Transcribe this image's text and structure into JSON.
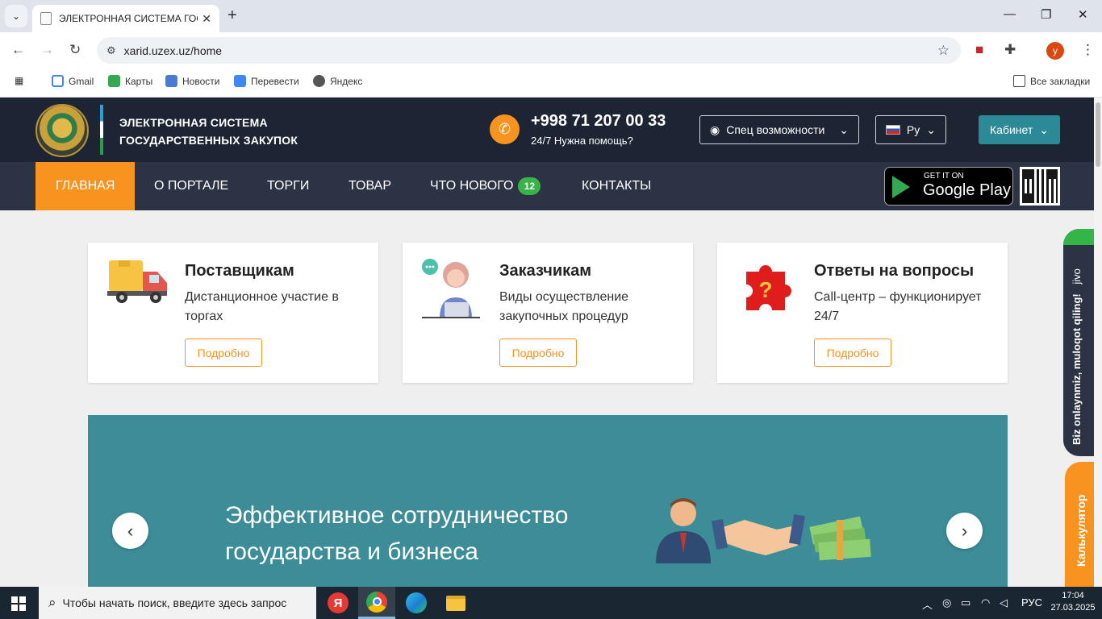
{
  "browser": {
    "tab_title": "ЭЛЕКТРОННАЯ СИСТЕМА ГОС",
    "url": "xarid.uzex.uz/home",
    "bookmarks": [
      "Gmail",
      "Карты",
      "Новости",
      "Перевести",
      "Яндекс"
    ],
    "all_bookmarks": "Все закладки",
    "profile_initial": "у"
  },
  "header": {
    "brand_line1": "ЭЛЕКТРОННАЯ СИСТЕМА",
    "brand_line2": "ГОСУДАРСТВЕННЫХ ЗАКУПОК",
    "phone": "+998 71 207 00 33",
    "phone_note": "24/7 Нужна помощь?",
    "accessibility": "Спец возможности",
    "language": "Ру",
    "cabinet": "Кабинет"
  },
  "nav": {
    "items": [
      "ГЛАВНАЯ",
      "О ПОРТАЛЕ",
      "ТОРГИ",
      "ТОВАР",
      "ЧТО НОВОГО",
      "КОНТАКТЫ"
    ],
    "news_count": "12",
    "gplay_small": "GET IT ON",
    "gplay_big": "Google Play"
  },
  "cards": [
    {
      "title": "Поставщикам",
      "text": "Дистанционное участие в торгах",
      "button": "Подробно"
    },
    {
      "title": "Заказчикам",
      "text": "Виды осуществление закупочных процедур",
      "button": "Подробно"
    },
    {
      "title": "Ответы на вопросы",
      "text": "Call-центр – функционирует 24/7",
      "button": "Подробно"
    }
  ],
  "banner": {
    "text": "Эффективное сотрудничество государства и бизнеса"
  },
  "side": {
    "chat": "Biz onlaynmiz, muloqot qiling!",
    "chat_brand": "jivo",
    "calculator": "Калькулятор"
  },
  "taskbar": {
    "search_placeholder": "Чтобы начать поиск, введите здесь запрос",
    "lang": "РУС",
    "time": "17:04",
    "date": "27.03.2025"
  },
  "colors": {
    "accent": "#f7931e",
    "header_bg": "#1d2433",
    "nav_bg": "#2b3344",
    "banner_bg": "#3d8d99",
    "cabinet_bg": "#2c8a96",
    "badge_green": "#38b349"
  }
}
